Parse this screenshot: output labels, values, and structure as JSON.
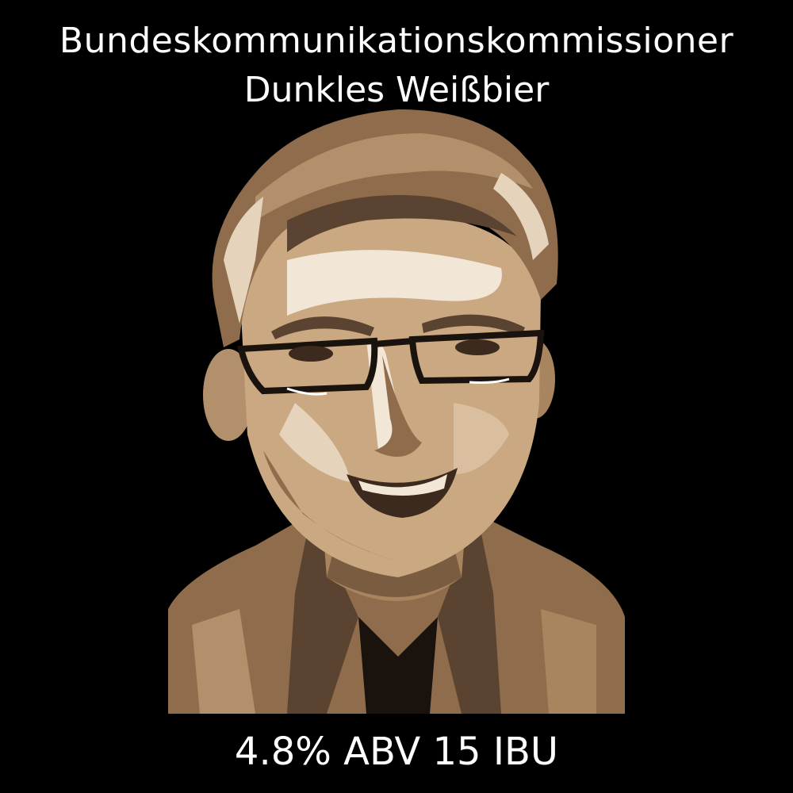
{
  "label": {
    "title": "Bundeskommunikationskommissioner",
    "style": "Dunkles Weißbier",
    "stats": "4.8% ABV 15 IBU"
  },
  "colors": {
    "background": "#000000",
    "text": "#ffffff",
    "portrait_light": "#f2e6d6",
    "portrait_mid": "#b3906c",
    "portrait_dark": "#5a4330"
  }
}
